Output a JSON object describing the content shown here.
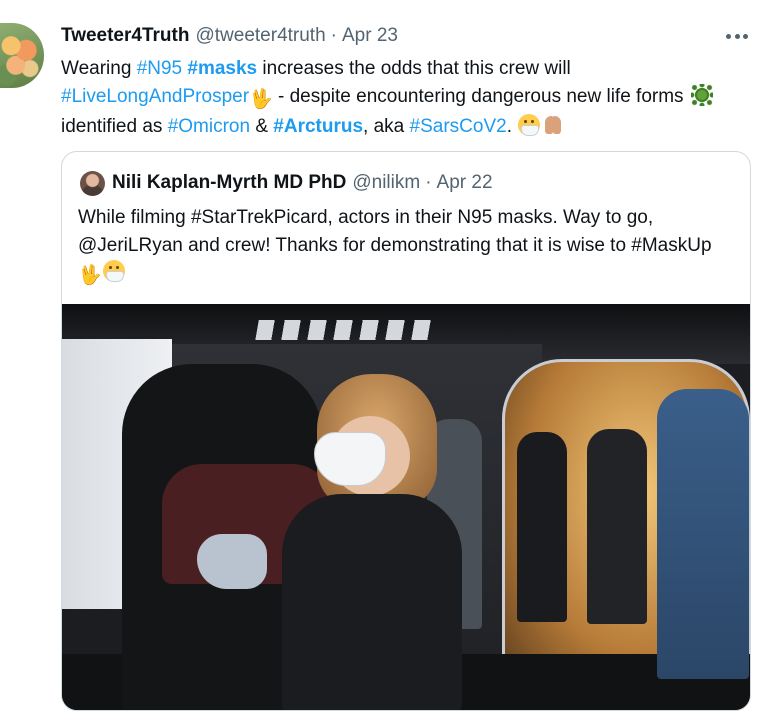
{
  "tweet": {
    "author_name": "Tweeter4Truth",
    "author_handle": "@tweeter4truth",
    "separator": "·",
    "date": "Apr 23",
    "more_label": "···",
    "text": {
      "t1": "Wearing ",
      "tag_n95": "#N95",
      "space1": " ",
      "tag_masks": "#masks",
      "t2": " increases the odds that this crew will ",
      "tag_llap": "#LiveLongAndProsper",
      "emoji_vulcan": "🖖",
      "t3": " - despite encountering dangerous new life forms ",
      "t4": " identified as ",
      "tag_omicron": "#Omicron",
      "t5": " & ",
      "tag_arcturus": "#Arcturus",
      "t6": ", aka ",
      "tag_sars": "#SarsCoV2",
      "t7": ". "
    }
  },
  "quoted": {
    "author_name": "Nili Kaplan-Myrth MD PhD",
    "author_handle": "@nilikm",
    "separator": "·",
    "date": "Apr 22",
    "text_line": "While filming #StarTrekPicard, actors in their N95 masks. Way to go, @JeriLRyan and crew! Thanks for demonstrating that it is wise to #MaskUp ",
    "emoji_vulcan": "🖖"
  },
  "icons": {
    "avatar": "flower-avatar",
    "virus": "microbe-icon",
    "mask": "mask-face-icon",
    "pray": "folded-hands-icon",
    "more": "more-icon"
  },
  "colors": {
    "link": "#1d9bf0",
    "text": "#0f1419",
    "muted": "#536471",
    "border": "#cfd9de"
  }
}
